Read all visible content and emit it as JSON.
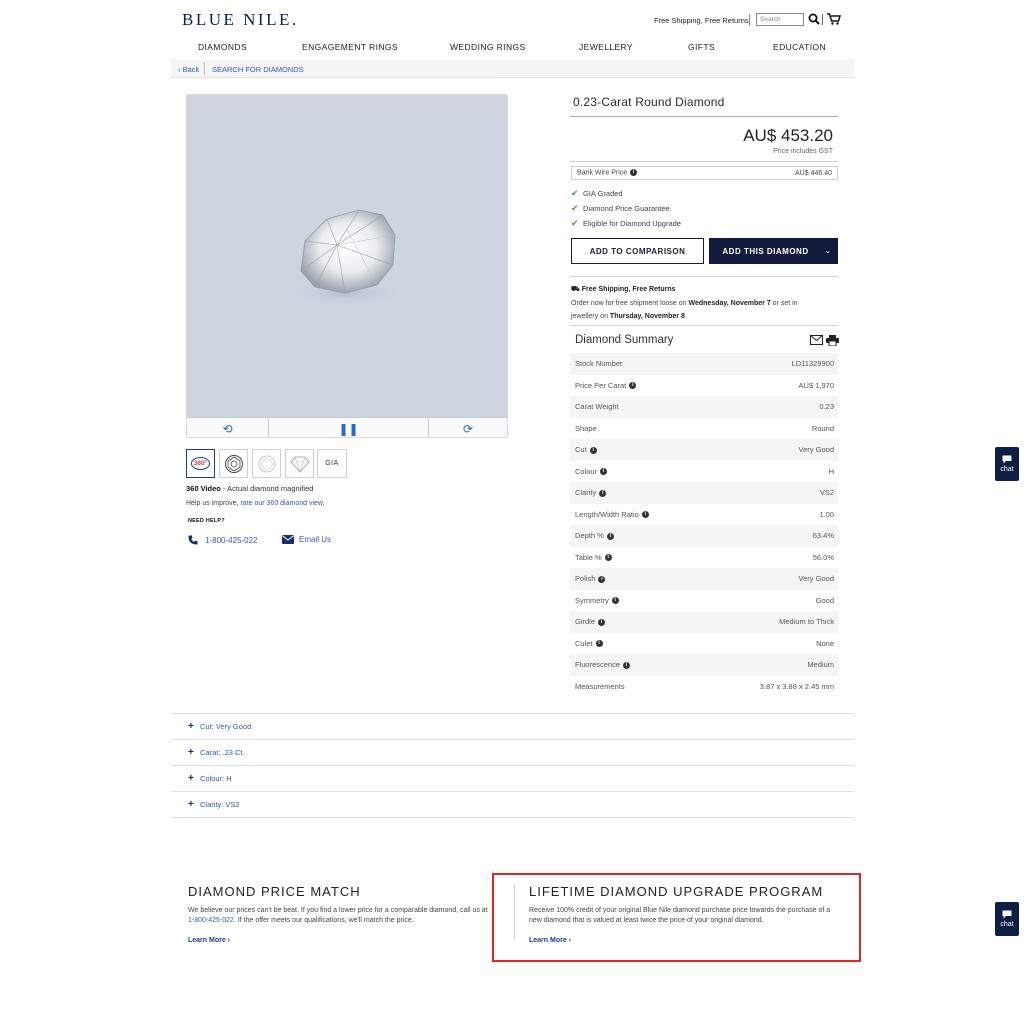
{
  "header": {
    "logo": "BLUE NILE.",
    "shipping": "Free Shipping, Free Returns",
    "search_placeholder": "Search"
  },
  "nav": [
    "DIAMONDS",
    "ENGAGEMENT RINGS",
    "WEDDING RINGS",
    "JEWELLERY",
    "GIFTS",
    "EDUCATION"
  ],
  "breadcrumb": {
    "back": "‹ Back",
    "current": "SEARCH FOR DIAMONDS"
  },
  "media": {
    "thumbs": [
      "360°",
      "",
      "",
      "",
      "GIA"
    ],
    "caption_bold": "360 Video",
    "caption_rest": " - Actual diamond magnified",
    "help_prefix": "Help us improve, ",
    "help_link": "rate our 360 diamond view.",
    "need_help": "NEED HELP?",
    "phone": "1-800-425-022",
    "email": "Email Us"
  },
  "product": {
    "title": "0.23-Carat Round Diamond",
    "price": "AU$ 453.20",
    "price_note": "Price includes GST",
    "wire_label": "Bank Wire Price",
    "wire_price": "AU$ 446.40",
    "checks": [
      "GIA Graded",
      "Diamond Price Guarantee",
      "Eligible for Diamond Upgrade"
    ],
    "btn_compare": "ADD TO COMPARISON",
    "btn_add": "ADD THIS DIAMOND",
    "shipping_head": "Free Shipping, Free Returns",
    "shipping_line1_a": "Order now for free shipment loose on ",
    "shipping_line1_b": "Wednesday, November 7",
    "shipping_line1_c": " or set in",
    "shipping_line2_a": "jewellery on ",
    "shipping_line2_b": "Thursday, November 8",
    "shipping_line2_c": "."
  },
  "summary": {
    "title": "Diamond Summary",
    "rows": [
      {
        "label": "Stock Number",
        "value": "LD11329900",
        "info": false
      },
      {
        "label": "Price Per Carat",
        "value": "AU$ 1,970",
        "info": true
      },
      {
        "label": "Carat Weight",
        "value": "0.23",
        "info": false
      },
      {
        "label": "Shape",
        "value": "Round",
        "info": false
      },
      {
        "label": "Cut",
        "value": "Very Good",
        "info": true
      },
      {
        "label": "Colour",
        "value": "H",
        "info": true
      },
      {
        "label": "Clarity",
        "value": "VS2",
        "info": true
      },
      {
        "label": "Length/Width Ratio",
        "value": "1.00",
        "info": true
      },
      {
        "label": "Depth %",
        "value": "63.4%",
        "info": true
      },
      {
        "label": "Table %",
        "value": "56.0%",
        "info": true
      },
      {
        "label": "Polish",
        "value": "Very Good",
        "info": true
      },
      {
        "label": "Symmetry",
        "value": "Good",
        "info": true
      },
      {
        "label": "Girdle",
        "value": "Medium to Thick",
        "info": true
      },
      {
        "label": "Culet",
        "value": "None",
        "info": true
      },
      {
        "label": "Fluorescence",
        "value": "Medium",
        "info": true
      },
      {
        "label": "Measurements",
        "value": "3.87 x 3.88 x 2.45 mm",
        "info": false
      }
    ]
  },
  "accordion": [
    "Cut: Very Good",
    "Carat: .23 Ct.",
    "Colour: H",
    "Clarity: VS2"
  ],
  "promo1": {
    "title": "DIAMOND PRICE MATCH",
    "text_a": "We believe our prices can't be beat. If you find a lower price for a comparable diamond, call us at ",
    "text_phone": "1-800-425-022",
    "text_b": ". If the offer meets our qualifications, we'll match the price.",
    "link": "Learn More ›"
  },
  "promo2": {
    "title": "LIFETIME DIAMOND UPGRADE PROGRAM",
    "text": "Receive 100% credit of your original Blue Nile diamond purchase price towards the purchase of a new diamond that is valued at least twice the price of your original diamond.",
    "link": "Learn More ›"
  },
  "chat_label": "chat",
  "colors": {
    "navy": "#141a3b",
    "link": "#3a56b8",
    "check": "#3aa35a",
    "highlight": "#e22424"
  }
}
